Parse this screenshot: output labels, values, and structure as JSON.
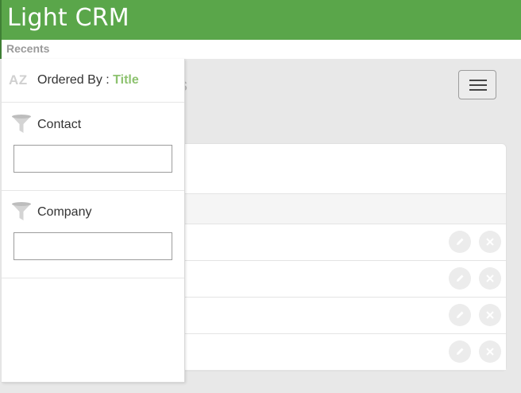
{
  "app": {
    "title": "Light CRM"
  },
  "recents": {
    "label": "Recents"
  },
  "page": {
    "title_fragment": "s"
  },
  "filters": {
    "ordered_by_label": "Ordered By :",
    "ordered_by_value": "Title",
    "sort_icon_text": "AZ",
    "fields": [
      {
        "label": "Contact",
        "value": "",
        "placeholder": ""
      },
      {
        "label": "Company",
        "value": "",
        "placeholder": ""
      }
    ]
  },
  "icons": {
    "menu": "hamburger-icon",
    "sort": "az-sort-icon",
    "filter": "funnel-icon",
    "edit": "pencil-icon",
    "delete": "close-icon"
  },
  "colors": {
    "header": "#5aa64a",
    "accent": "#8dc26f",
    "muted_icon": "#d0d0d0"
  },
  "table": {
    "row_count": 4
  }
}
